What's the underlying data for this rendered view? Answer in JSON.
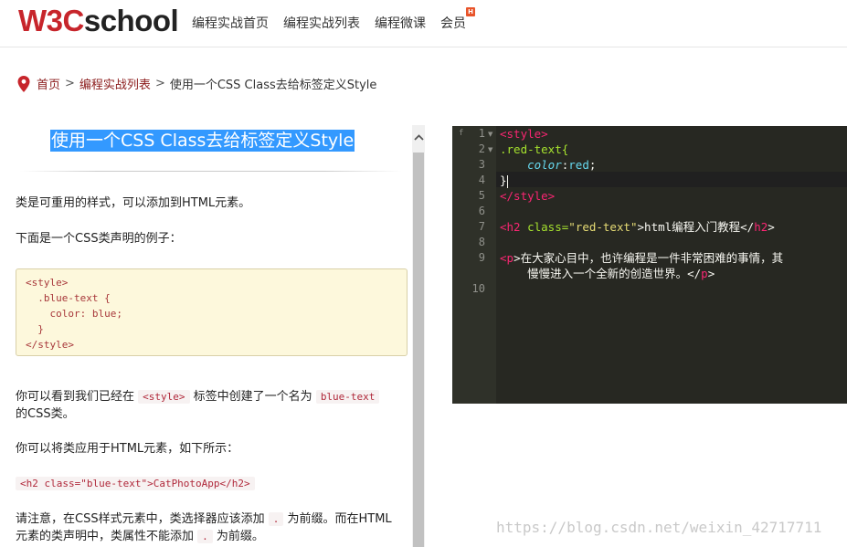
{
  "header": {
    "logo_w3c": "W3C",
    "logo_school": "school",
    "nav": [
      "编程实战首页",
      "编程实战列表",
      "编程微课",
      "会员"
    ],
    "vip_badge": "H"
  },
  "breadcrumb": {
    "home": "首页",
    "sep": ">",
    "list": "编程实战列表",
    "current": "使用一个CSS Class去给标签定义Style"
  },
  "lesson": {
    "title": "使用一个CSS Class去给标签定义Style",
    "p1": "类是可重用的样式，可以添加到HTML元素。",
    "p2": "下面是一个CSS类声明的例子：",
    "code_example": "<style>\n  .blue-text {\n    color: blue;\n  }\n</style>",
    "p3_before": "你可以看到我们已经在",
    "p3_code1": "<style>",
    "p3_mid": "标签中创建了一个名为",
    "p3_code2": "blue-text",
    "p3_after": "的CSS类。",
    "p4": "你可以将类应用于HTML元素，如下所示：",
    "p5_code": "<h2 class=\"blue-text\">CatPhotoApp</h2>",
    "p6_a": "请注意，在CSS样式元素中，类选择器应该添加",
    "p6_code1": ".",
    "p6_b": "为前缀。而在HTML",
    "p6_c": "元素的类声明中，类属性不能添加",
    "p6_code2": ".",
    "p6_d": "为前缀。"
  },
  "editor": {
    "fold_marker": "f",
    "line_numbers": [
      "1",
      "2",
      "3",
      "4",
      "5",
      "6",
      "7",
      "8",
      "9",
      "10"
    ],
    "l1": "<style>",
    "l2": ".red-text{",
    "l3_prop": "color",
    "l3_val": "red",
    "l4": "}",
    "l5": "</style>",
    "l7_open": "<h2",
    "l7_attr": "class=",
    "l7_str": "\"red-text\"",
    "l7_text": ">html编程入门教程</",
    "l7_close": "h2",
    "l9_open": "<p",
    "l9_text": ">在大家心目中，也许编程是一件非常困难的事情，其",
    "l9b_text": "慢慢进入一个全新的创造世界。</",
    "l9b_close": "p"
  },
  "watermark": "https://blog.csdn.net/weixin_42717711",
  "colors": {
    "brand": "#c7252b",
    "highlight": "#3399ff",
    "editor_bg": "#272822"
  }
}
